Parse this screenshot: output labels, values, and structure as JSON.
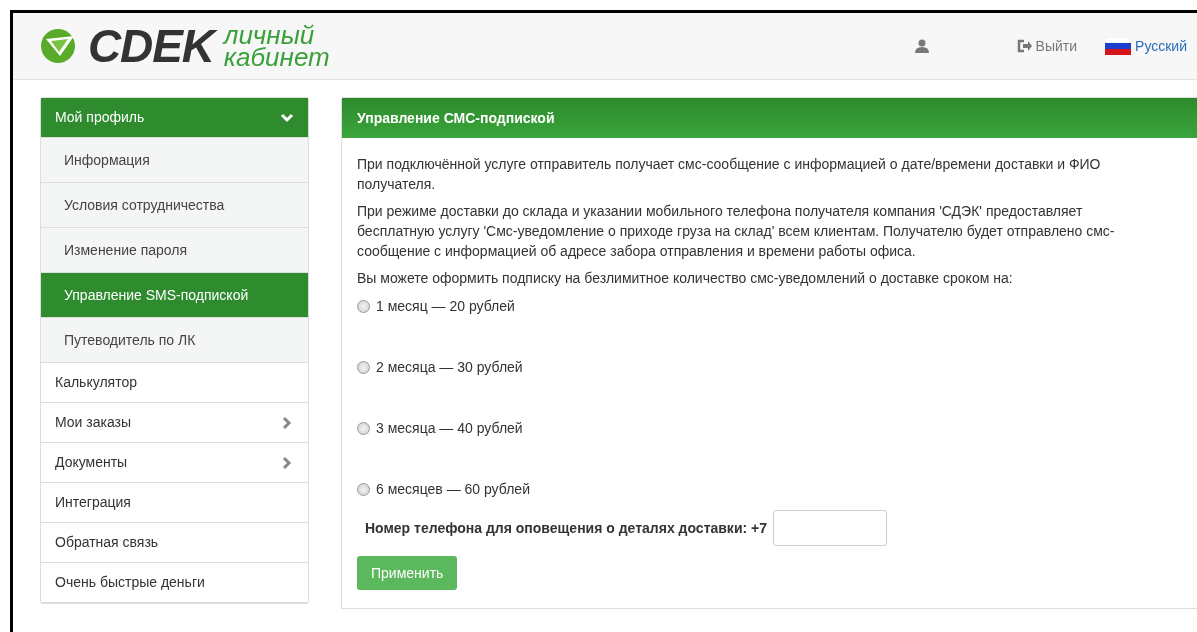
{
  "header": {
    "logo": {
      "brand": "CDEK",
      "subtitle_line1": "личный",
      "subtitle_line2": "кабинет"
    },
    "logout": "Выйти",
    "language": "Русский"
  },
  "sidebar": {
    "items": [
      {
        "label": "Мой профиль",
        "expanded": true,
        "children": [
          {
            "label": "Информация",
            "selected": false
          },
          {
            "label": "Условия сотрудничества",
            "selected": false
          },
          {
            "label": "Изменение пароля",
            "selected": false
          },
          {
            "label": "Управление SMS-подпиской",
            "selected": true
          },
          {
            "label": "Путеводитель по ЛК",
            "selected": false
          }
        ]
      },
      {
        "label": "Калькулятор",
        "selected": false
      },
      {
        "label": "Мои заказы",
        "selected": false,
        "expanded": false
      },
      {
        "label": "Документы",
        "selected": false,
        "expanded": false
      },
      {
        "label": "Интеграция",
        "selected": false
      },
      {
        "label": "Обратная связь",
        "selected": false
      },
      {
        "label": "Очень быстрые деньги",
        "selected": false
      }
    ]
  },
  "panel": {
    "title": "Управление СМС-подпиской",
    "paragraphs": [
      "При подключённой услуге отправитель получает смс-сообщение с информацией о дате/времени доставки и ФИО получателя.",
      "При режиме доставки до склада и указании мобильного телефона получателя компания 'СДЭК' предоставляет бесплатную услугу 'Смс-уведомление о приходе груза на склад' всем клиентам. Получателю будет отправлено смс-сообщение с информацией об адресе забора отправления и времени работы офиса.",
      "Вы можете оформить подписку на безлимитное количество смс-уведомлений о доставке сроком на:"
    ],
    "options": [
      {
        "label": "1 месяц — 20 рублей",
        "selected": false
      },
      {
        "label": "2 месяца — 30 рублей",
        "selected": false
      },
      {
        "label": "3 месяца — 40 рублей",
        "selected": false
      },
      {
        "label": "6 месяцев — 60 рублей",
        "selected": false
      }
    ],
    "phone_label": "Номер телефона для оповещения о деталях доставки: +7",
    "apply_button": "Применить"
  }
}
